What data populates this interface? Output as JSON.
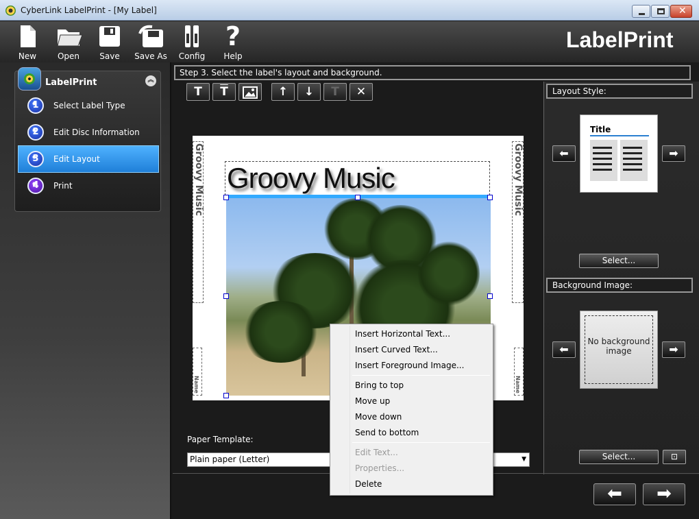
{
  "window": {
    "title": "CyberLink LabelPrint - [My Label]"
  },
  "toolbar": {
    "items": [
      {
        "label": "New",
        "icon": "new-document-icon"
      },
      {
        "label": "Open",
        "icon": "folder-icon"
      },
      {
        "label": "Save",
        "icon": "floppy-icon"
      },
      {
        "label": "Save As",
        "icon": "save-as-icon"
      },
      {
        "label": "Config",
        "icon": "tools-icon"
      },
      {
        "label": "Help",
        "icon": "question-icon"
      }
    ],
    "brand": "LabelPrint"
  },
  "wizard": {
    "title": "LabelPrint",
    "steps": [
      {
        "num": "1",
        "label": "Select Label Type"
      },
      {
        "num": "2",
        "label": "Edit Disc Information"
      },
      {
        "num": "3",
        "label": "Edit Layout"
      },
      {
        "num": "4",
        "label": "Print"
      }
    ],
    "active_step": 3
  },
  "step_bar": "Step 3. Select the label's layout and background.",
  "center_tools": [
    "T",
    "T",
    "img",
    "↑",
    "↓",
    "T",
    "✕"
  ],
  "canvas": {
    "title_text": "Groovy Music",
    "side_text_left": "Groovy Music",
    "side_text_right": "Groovy Music",
    "small_left": "Name",
    "small_right": "Name"
  },
  "paper_template": {
    "label": "Paper Template:",
    "value": "Plain paper (Letter)"
  },
  "right_panel": {
    "layout_style_label": "Layout Style:",
    "layout_thumb_title": "Title",
    "layout_select": "Select...",
    "background_label": "Background Image:",
    "background_text": "No background image",
    "background_select": "Select..."
  },
  "context_menu": {
    "items": [
      {
        "label": "Insert Horizontal Text...",
        "enabled": true
      },
      {
        "label": "Insert Curved Text...",
        "enabled": true
      },
      {
        "label": "Insert Foreground Image...",
        "enabled": true
      },
      {
        "label": "Bring to top",
        "enabled": true
      },
      {
        "label": "Move up",
        "enabled": true
      },
      {
        "label": "Move down",
        "enabled": true
      },
      {
        "label": "Send to bottom",
        "enabled": true
      },
      {
        "label": "Edit Text...",
        "enabled": false
      },
      {
        "label": "Properties...",
        "enabled": false
      },
      {
        "label": "Delete",
        "enabled": true
      }
    ]
  },
  "colors": {
    "accent": "#1f7fd8",
    "dark_bg": "#1e1e1e"
  }
}
